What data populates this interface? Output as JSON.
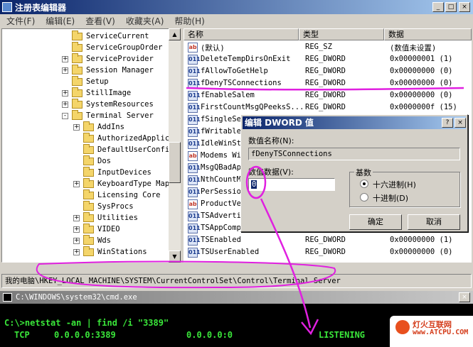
{
  "window": {
    "title": "注册表编辑器",
    "title_icon": "regedit-icon"
  },
  "menu": [
    "文件(F)",
    "编辑(E)",
    "查看(V)",
    "收藏夹(A)",
    "帮助(H)"
  ],
  "tree": [
    {
      "label": "ServiceCurrent",
      "expander": ""
    },
    {
      "label": "ServiceGroupOrder",
      "expander": ""
    },
    {
      "label": "ServiceProvider",
      "expander": "+"
    },
    {
      "label": "Session Manager",
      "expander": "+"
    },
    {
      "label": "Setup",
      "expander": ""
    },
    {
      "label": "StillImage",
      "expander": "+"
    },
    {
      "label": "SystemResources",
      "expander": "+"
    },
    {
      "label": "Terminal Server",
      "expander": "-"
    },
    {
      "label": "AddIns",
      "expander": "+"
    },
    {
      "label": "AuthorizedApplic",
      "expander": ""
    },
    {
      "label": "DefaultUserConfi",
      "expander": ""
    },
    {
      "label": "Dos",
      "expander": ""
    },
    {
      "label": "InputDevices",
      "expander": ""
    },
    {
      "label": "KeyboardType Map",
      "expander": "+"
    },
    {
      "label": "Licensing Core",
      "expander": ""
    },
    {
      "label": "SysProcs",
      "expander": ""
    },
    {
      "label": "Utilities",
      "expander": "+"
    },
    {
      "label": "VIDEO",
      "expander": "+"
    },
    {
      "label": "Wds",
      "expander": "+"
    },
    {
      "label": "WinStations",
      "expander": "+"
    }
  ],
  "columns": {
    "name": "名称",
    "type": "类型",
    "data": "数据"
  },
  "values": [
    {
      "name": "(默认)",
      "type": "REG_SZ",
      "data": "(数值未设置)",
      "kind": "sz"
    },
    {
      "name": "DeleteTempDirsOnExit",
      "type": "REG_DWORD",
      "data": "0x00000001 (1)",
      "kind": "dw"
    },
    {
      "name": "fAllowToGetHelp",
      "type": "REG_DWORD",
      "data": "0x00000000 (0)",
      "kind": "dw"
    },
    {
      "name": "fDenyTSConnections",
      "type": "REG_DWORD",
      "data": "0x00000000 (0)",
      "kind": "dw"
    },
    {
      "name": "fEnableSalem",
      "type": "REG_DWORD",
      "data": "0x00000000 (0)",
      "kind": "dw"
    },
    {
      "name": "FirstCountMsgQPeeksS...",
      "type": "REG_DWORD",
      "data": "0x0000000f (15)",
      "kind": "dw"
    },
    {
      "name": "fSingleSe",
      "type": "",
      "data": "",
      "kind": "dw"
    },
    {
      "name": "fWritable",
      "type": "",
      "data": "",
      "kind": "dw"
    },
    {
      "name": "IdleWinSt",
      "type": "",
      "data": "",
      "kind": "dw"
    },
    {
      "name": "Modems Wi",
      "type": "",
      "data": "",
      "kind": "sz"
    },
    {
      "name": "MsgQBadAp",
      "type": "",
      "data": "",
      "kind": "dw"
    },
    {
      "name": "NthCountM",
      "type": "",
      "data": "",
      "kind": "dw"
    },
    {
      "name": "PerSessio",
      "type": "",
      "data": "",
      "kind": "dw"
    },
    {
      "name": "ProductVe",
      "type": "",
      "data": "",
      "kind": "sz"
    },
    {
      "name": "TSAdverti",
      "type": "",
      "data": "",
      "kind": "dw"
    },
    {
      "name": "TSAppComp",
      "type": "",
      "data": "",
      "kind": "dw"
    },
    {
      "name": "TSEnabled",
      "type": "REG_DWORD",
      "data": "0x00000000 (1)",
      "kind": "dw"
    },
    {
      "name": "TSUserEnabled",
      "type": "REG_DWORD",
      "data": "0x00000000 (0)",
      "kind": "dw"
    }
  ],
  "status_path": "我的电脑\\HKEY_LOCAL_MACHINE\\SYSTEM\\CurrentControlSet\\Control\\Terminal Server",
  "dialog": {
    "title": "编辑 DWORD 值",
    "help_btn": "?",
    "close_btn": "×",
    "name_label": "数值名称(N):",
    "name_value": "fDenyTSConnections",
    "data_label": "数值数据(V):",
    "data_value": "0",
    "base_label": "基数",
    "hex_label": "十六进制(H)",
    "dec_label": "十进制(D)",
    "selected_base": "hex",
    "ok": "确定",
    "cancel": "取消"
  },
  "cmd": {
    "title": "C:\\WINDOWS\\system32\\cmd.exe",
    "command": "C:\\>netstat -an | find /i \"3389\"",
    "result_proto": "TCP",
    "result_local": "0.0.0.0:3389",
    "result_remote": "0.0.0.0:0",
    "result_state": "LISTENING"
  },
  "watermark": {
    "line1": "灯火互联网",
    "line2": "www.ATCPU.COM"
  },
  "colors": {
    "annotation": "#e020e0",
    "title_bar": "#0a246a",
    "console_text": "#3ae63a"
  }
}
